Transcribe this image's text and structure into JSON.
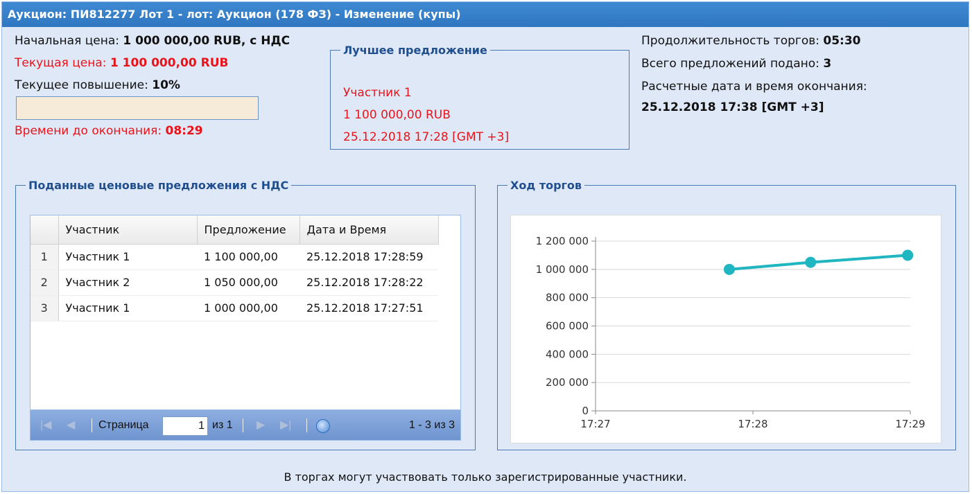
{
  "window": {
    "title": "Аукцион: ПИ812277 Лот 1 - лот: Аукцион (178 ФЗ) - Изменение (купы)"
  },
  "left_info": {
    "start_price_label": "Начальная цена:",
    "start_price_value": "1 000 000,00 RUB, с НДС",
    "current_price_label": "Текущая цена:",
    "current_price_value": "1 100 000,00 RUB",
    "current_increase_label": "Текущее повышение:",
    "current_increase_value": "10%",
    "time_left_label": "Времени до окончания:",
    "time_left_value": "08:29"
  },
  "best_offer": {
    "legend": "Лучшее предложение",
    "participant": "Участник 1",
    "amount": "1 100 000,00 RUB",
    "datetime": "25.12.2018 17:28 [GMT +3]"
  },
  "right_info": {
    "duration_label": "Продолжительность торгов:",
    "duration_value": "05:30",
    "total_offers_label": "Всего предложений подано:",
    "total_offers_value": "3",
    "end_time_label": "Расчетные дата и время окончания:",
    "end_time_value": "25.12.2018 17:38 [GMT +3]"
  },
  "offers_panel": {
    "legend": "Поданные ценовые предложения с НДС",
    "columns": [
      "Участник",
      "Предложение",
      "Дата и Время"
    ],
    "rows": [
      {
        "num": "1",
        "participant": "Участник 1",
        "offer": "1 100 000,00",
        "datetime": "25.12.2018 17:28:59"
      },
      {
        "num": "2",
        "participant": "Участник 2",
        "offer": "1 050 000,00",
        "datetime": "25.12.2018 17:28:22"
      },
      {
        "num": "3",
        "participant": "Участник 1",
        "offer": "1 000 000,00",
        "datetime": "25.12.2018 17:27:51"
      }
    ],
    "pager": {
      "page_label": "Страница",
      "page_value": "1",
      "of_label": "из 1",
      "summary": "1 - 3 из 3",
      "icons": [
        "first-page-icon",
        "prev-page-icon",
        "next-page-icon",
        "last-page-icon",
        "refresh-icon"
      ]
    }
  },
  "chart_panel": {
    "legend": "Ход торгов"
  },
  "chart_data": {
    "type": "line",
    "title": "",
    "xlabel": "",
    "ylabel": "",
    "x_ticks": [
      "17:27",
      "17:28",
      "17:29"
    ],
    "y_ticks": [
      "0",
      "200 000",
      "400 000",
      "600 000",
      "800 000",
      "1 000 000",
      "1 200 000"
    ],
    "ylim": [
      0,
      1200000
    ],
    "xlim": [
      "17:27:00",
      "17:29:00"
    ],
    "grid": true,
    "series": [
      {
        "color": "#1fb6c1",
        "points": [
          {
            "x": "17:27:51",
            "y": 1000000
          },
          {
            "x": "17:28:22",
            "y": 1050000
          },
          {
            "x": "17:28:59",
            "y": 1100000
          }
        ]
      }
    ]
  },
  "footer": {
    "note": "В торгах могут участвовать только зарегистрированные участники."
  }
}
